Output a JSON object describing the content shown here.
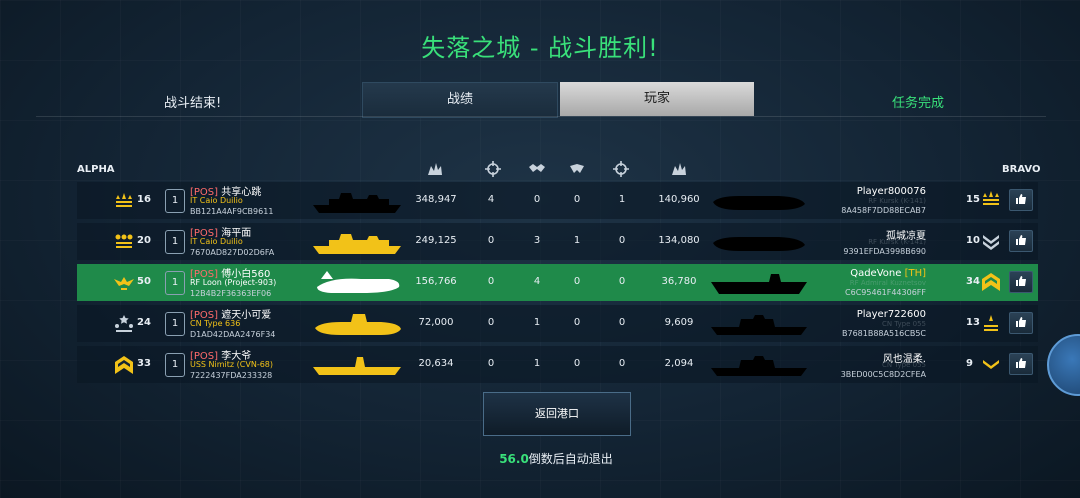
{
  "title": "失落之城 - 战斗胜利!",
  "topbar": {
    "left_label": "战斗结束!",
    "tabs": [
      "战绩",
      "玩家"
    ],
    "right_label": "任务完成"
  },
  "teams": {
    "left": "ALPHA",
    "right": "BRAVO"
  },
  "columns": [
    "damage-icon",
    "target-icon",
    "support-icon",
    "support-icon",
    "target-icon",
    "damage-icon"
  ],
  "rows": [
    {
      "rank": "16",
      "slot": "1",
      "tag": "[POS]",
      "name": "共享心跳",
      "ship": "IT Caio Duilio",
      "id": "BB121A4AF9CB9611",
      "damage": "348,947",
      "c2": "4",
      "c3": "0",
      "c4": "0",
      "c5": "1",
      "c6": "140,960",
      "opp_name": "Player800076",
      "opp_tag": "",
      "opp_ghost": "RF Kursk (K-141)",
      "opp_id": "8A458F7DD88ECAB7",
      "opp_rank": "15",
      "highlight": false,
      "ship_color": "#000000"
    },
    {
      "rank": "20",
      "slot": "1",
      "tag": "[POS]",
      "name": "海平面",
      "ship": "IT Caio Duilio",
      "id": "7670AD827D02D6FA",
      "damage": "249,125",
      "c2": "0",
      "c3": "3",
      "c4": "1",
      "c5": "0",
      "c6": "134,080",
      "opp_name": "孤城凉夏",
      "opp_tag": "",
      "opp_ghost": "RF Kursk (K-141)",
      "opp_id": "9391EFDA3998B690",
      "opp_rank": "10",
      "highlight": false,
      "ship_color": "#f2c218"
    },
    {
      "rank": "50",
      "slot": "1",
      "tag": "[POS]",
      "name": "傅小白560",
      "ship": "RF Loon (Project-903)",
      "id": "12B4B2F36363EF06",
      "damage": "156,766",
      "c2": "0",
      "c3": "4",
      "c4": "0",
      "c5": "0",
      "c6": "36,780",
      "opp_name": "QadeVone",
      "opp_tag": "[TH]",
      "opp_ghost": "RF Admiral Kuznetsov",
      "opp_id": "C6C95461F44306FF",
      "opp_rank": "34",
      "highlight": true,
      "ship_color": "#ffffff"
    },
    {
      "rank": "24",
      "slot": "1",
      "tag": "[POS]",
      "name": "遮天小可爱",
      "ship": "CN Type 636",
      "id": "D1AD42DAA2476F34",
      "damage": "72,000",
      "c2": "0",
      "c3": "1",
      "c4": "0",
      "c5": "0",
      "c6": "9,609",
      "opp_name": "Player722600",
      "opp_tag": "",
      "opp_ghost": "CN Type 055",
      "opp_id": "B7681B88A516CB5C",
      "opp_rank": "13",
      "highlight": false,
      "ship_color": "#f2c218"
    },
    {
      "rank": "33",
      "slot": "1",
      "tag": "[POS]",
      "name": "李大爷",
      "ship": "USS Nimitz (CVN-68)",
      "id": "7222437FDA233328",
      "damage": "20,634",
      "c2": "0",
      "c3": "1",
      "c4": "0",
      "c5": "0",
      "c6": "2,094",
      "opp_name": "风也温柔.",
      "opp_tag": "",
      "opp_ghost": "CN Type 055",
      "opp_id": "3BED00C5C8D2CFEA",
      "opp_rank": "9",
      "highlight": false,
      "ship_color": "#f2c218"
    }
  ],
  "back_button": "返回港口",
  "countdown": {
    "seconds": "56.0",
    "text": "倒数后自动退出"
  },
  "colors": {
    "accent_green": "#39e07a",
    "highlight_row": "#1f8a4a",
    "clan_tag": "#ff6b6b",
    "ship_name": "#f2c218"
  }
}
